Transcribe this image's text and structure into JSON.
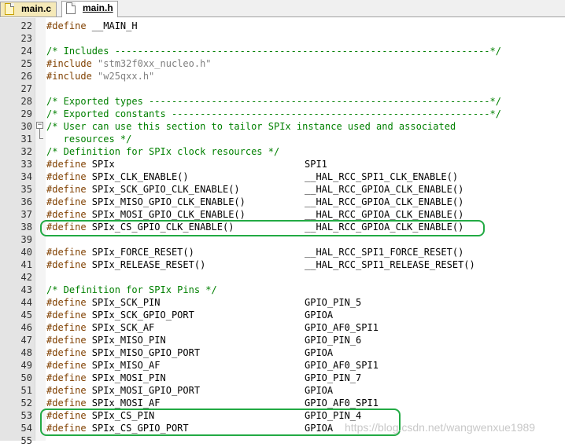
{
  "tabs": [
    {
      "label": "main.c",
      "active": false
    },
    {
      "label": "main.h",
      "active": true
    }
  ],
  "lines": [
    {
      "n": "22",
      "kind": "pp",
      "a": "#define",
      "b": " __MAIN_H",
      "v": ""
    },
    {
      "n": "23",
      "kind": "blank",
      "a": "",
      "b": "",
      "v": ""
    },
    {
      "n": "24",
      "kind": "cmt",
      "a": "/* Includes ------------------------------------------------------------------*/",
      "b": "",
      "v": ""
    },
    {
      "n": "25",
      "kind": "inc",
      "a": "#include",
      "b": " \"stm32f0xx_nucleo.h\"",
      "v": ""
    },
    {
      "n": "26",
      "kind": "inc",
      "a": "#include",
      "b": " \"w25qxx.h\"",
      "v": ""
    },
    {
      "n": "27",
      "kind": "blank",
      "a": "",
      "b": "",
      "v": ""
    },
    {
      "n": "28",
      "kind": "cmt",
      "a": "/* Exported types ------------------------------------------------------------*/",
      "b": "",
      "v": ""
    },
    {
      "n": "29",
      "kind": "cmt",
      "a": "/* Exported constants --------------------------------------------------------*/",
      "b": "",
      "v": ""
    },
    {
      "n": "30",
      "kind": "cmt",
      "a": "/* User can use this section to tailor SPIx instance used and associated",
      "b": "",
      "v": ""
    },
    {
      "n": "31",
      "kind": "cmt",
      "a": "   resources */",
      "b": "",
      "v": ""
    },
    {
      "n": "32",
      "kind": "cmt",
      "a": "/* Definition for SPIx clock resources */",
      "b": "",
      "v": ""
    },
    {
      "n": "33",
      "kind": "pp",
      "a": "#define",
      "b": " SPIx",
      "v": "SPI1"
    },
    {
      "n": "34",
      "kind": "pp",
      "a": "#define",
      "b": " SPIx_CLK_ENABLE()",
      "v": "__HAL_RCC_SPI1_CLK_ENABLE()"
    },
    {
      "n": "35",
      "kind": "pp",
      "a": "#define",
      "b": " SPIx_SCK_GPIO_CLK_ENABLE()",
      "v": "__HAL_RCC_GPIOA_CLK_ENABLE()"
    },
    {
      "n": "36",
      "kind": "pp",
      "a": "#define",
      "b": " SPIx_MISO_GPIO_CLK_ENABLE()",
      "v": "__HAL_RCC_GPIOA_CLK_ENABLE()"
    },
    {
      "n": "37",
      "kind": "pp",
      "a": "#define",
      "b": " SPIx_MOSI_GPIO_CLK_ENABLE()",
      "v": "__HAL_RCC_GPIOA_CLK_ENABLE()"
    },
    {
      "n": "38",
      "kind": "pp",
      "a": "#define",
      "b": " SPIx_CS_GPIO_CLK_ENABLE()",
      "v": "__HAL_RCC_GPIOA_CLK_ENABLE()"
    },
    {
      "n": "39",
      "kind": "blank",
      "a": "",
      "b": "",
      "v": ""
    },
    {
      "n": "40",
      "kind": "pp",
      "a": "#define",
      "b": " SPIx_FORCE_RESET()",
      "v": "__HAL_RCC_SPI1_FORCE_RESET()"
    },
    {
      "n": "41",
      "kind": "pp",
      "a": "#define",
      "b": " SPIx_RELEASE_RESET()",
      "v": "__HAL_RCC_SPI1_RELEASE_RESET()"
    },
    {
      "n": "42",
      "kind": "blank",
      "a": "",
      "b": "",
      "v": ""
    },
    {
      "n": "43",
      "kind": "cmt",
      "a": "/* Definition for SPIx Pins */",
      "b": "",
      "v": ""
    },
    {
      "n": "44",
      "kind": "pp",
      "a": "#define",
      "b": " SPIx_SCK_PIN",
      "v": "GPIO_PIN_5"
    },
    {
      "n": "45",
      "kind": "pp",
      "a": "#define",
      "b": " SPIx_SCK_GPIO_PORT",
      "v": "GPIOA"
    },
    {
      "n": "46",
      "kind": "pp",
      "a": "#define",
      "b": " SPIx_SCK_AF",
      "v": "GPIO_AF0_SPI1"
    },
    {
      "n": "47",
      "kind": "pp",
      "a": "#define",
      "b": " SPIx_MISO_PIN",
      "v": "GPIO_PIN_6"
    },
    {
      "n": "48",
      "kind": "pp",
      "a": "#define",
      "b": " SPIx_MISO_GPIO_PORT",
      "v": "GPIOA"
    },
    {
      "n": "49",
      "kind": "pp",
      "a": "#define",
      "b": " SPIx_MISO_AF",
      "v": "GPIO_AF0_SPI1"
    },
    {
      "n": "50",
      "kind": "pp",
      "a": "#define",
      "b": " SPIx_MOSI_PIN",
      "v": "GPIO_PIN_7"
    },
    {
      "n": "51",
      "kind": "pp",
      "a": "#define",
      "b": " SPIx_MOSI_GPIO_PORT",
      "v": "GPIOA"
    },
    {
      "n": "52",
      "kind": "pp",
      "a": "#define",
      "b": " SPIx_MOSI_AF",
      "v": "GPIO_AF0_SPI1"
    },
    {
      "n": "53",
      "kind": "pp",
      "a": "#define",
      "b": " SPIx_CS_PIN",
      "v": "GPIO_PIN_4"
    },
    {
      "n": "54",
      "kind": "pp",
      "a": "#define",
      "b": " SPIx_CS_GPIO_PORT",
      "v": "GPIOA"
    },
    {
      "n": "55",
      "kind": "blank",
      "a": "",
      "b": "",
      "v": ""
    }
  ],
  "watermark": "https://blog.csdn.net/wangwenxue1989",
  "colors": {
    "comment": "#008000",
    "preprocessor": "#804000",
    "string": "#808080",
    "highlight_box": "#22aa44"
  }
}
